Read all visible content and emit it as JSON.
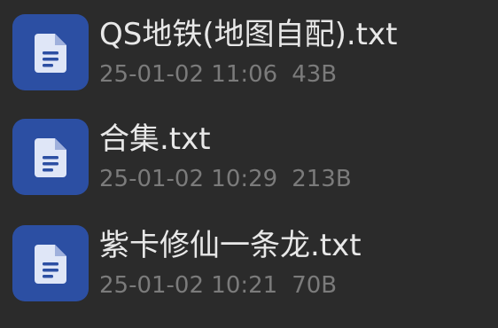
{
  "files": [
    {
      "name": "QS地铁(地图自配).txt",
      "datetime": "25-01-02 11:06",
      "size": "43B",
      "icon": "document-icon"
    },
    {
      "name": "合集.txt",
      "datetime": "25-01-02 10:29",
      "size": "213B",
      "icon": "document-icon"
    },
    {
      "name": "紫卡修仙一条龙.txt",
      "datetime": "25-01-02 10:21",
      "size": "70B",
      "icon": "document-icon"
    }
  ],
  "colors": {
    "background": "#2b2b2b",
    "icon_tile": "#2c4fa3",
    "icon_glyph": "#dfe6f7",
    "name_text": "#e8e8e8",
    "meta_text": "#7b7b7b"
  }
}
